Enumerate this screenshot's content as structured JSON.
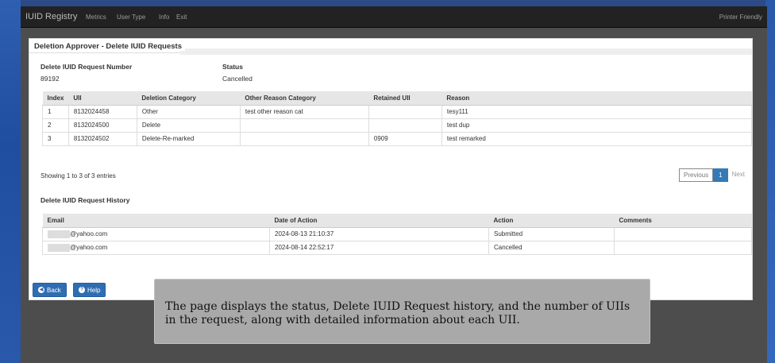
{
  "navbar": {
    "brand": "IUID Registry",
    "items": [
      "Metrics",
      "User Type",
      "Info",
      "Exit"
    ],
    "printer_friendly": "Printer Friendly"
  },
  "panel": {
    "title": "Deletion Approver - Delete IUID Requests",
    "request_number_label": "Delete IUID Request Number",
    "request_number": "89192",
    "status_label": "Status",
    "status": "Cancelled"
  },
  "uii_table": {
    "headers": [
      "Index",
      "UII",
      "Deletion Category",
      "Other Reason Category",
      "Retained UII",
      "Reason"
    ],
    "rows": [
      [
        "1",
        "8132024458",
        "Other",
        "test other reason cat",
        "",
        "tesy111"
      ],
      [
        "2",
        "8132024500",
        "Delete",
        "",
        "",
        "test dup"
      ],
      [
        "3",
        "8132024502",
        "Delete-Re-marked",
        "",
        "0909",
        "test remarked"
      ]
    ],
    "showing": "Showing 1 to 3 of 3 entries",
    "pager": {
      "previous": "Previous",
      "page": "1",
      "next": "Next"
    }
  },
  "history": {
    "title": "Delete IUID Request History",
    "headers": [
      "Email",
      "Date of Action",
      "Action",
      "Comments"
    ],
    "rows": [
      [
        "@yahoo.com",
        "2024-08-13 21:10:37",
        "Submitted",
        ""
      ],
      [
        "@yahoo.com",
        "2024-08-14 22:52:17",
        "Cancelled",
        ""
      ]
    ]
  },
  "buttons": {
    "back": "Back",
    "help": "Help"
  },
  "caption": "The page displays the status, Delete IUID Request history, and the number of UIIs in the request, along with detailed information about each UII."
}
